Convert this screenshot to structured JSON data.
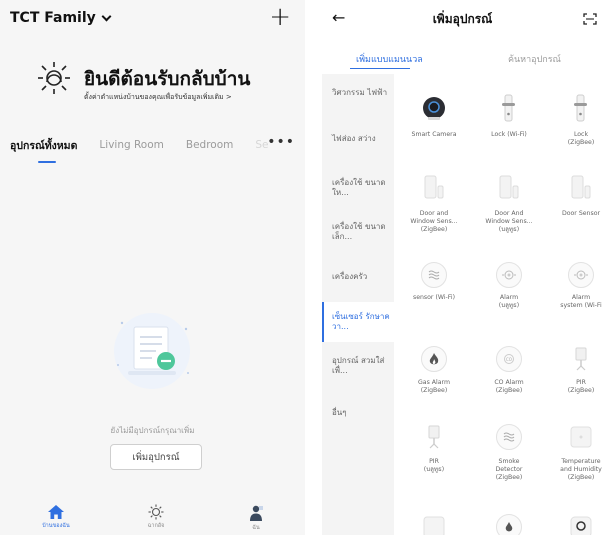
{
  "home": {
    "family_name": "TCT Family",
    "welcome_title": "ยินดีต้อนรับกลับบ้าน",
    "welcome_subtitle": "ตั้งค่าตำแหน่งบ้านของคุณเพื่อรับข้อมูลเพิ่มเติม >",
    "tabs": [
      {
        "label": "อุปกรณ์ทั้งหมด"
      },
      {
        "label": "Living Room"
      },
      {
        "label": "Bedroom"
      },
      {
        "label": "Se"
      }
    ],
    "empty_text": "ยังไม่มีอุปกรณ์กรุณาเพิ่ม",
    "add_button": "เพิ่มอุปกรณ์",
    "bottom_nav": [
      {
        "label": "บ้านของฉัน"
      },
      {
        "label": "ฉากอัจ"
      },
      {
        "label": "ฉัน"
      }
    ],
    "accent_color": "#2f6fe0"
  },
  "add_device": {
    "title": "เพิ่มอุปกรณ์",
    "tabs": [
      {
        "label": "เพิ่มแบบแมนนวล"
      },
      {
        "label": "ค้นหาอุปกรณ์"
      }
    ],
    "categories": [
      {
        "label": "วิศวกรรม\nไฟฟ้า"
      },
      {
        "label": "ไฟส่อง\nสว่าง"
      },
      {
        "label": "เครื่องใช้\nขนาดให..."
      },
      {
        "label": "เครื่องใช้\nขนาดเล็ก..."
      },
      {
        "label": "เครื่องครัว"
      },
      {
        "label": "เซ็นเซอร์\nรักษาควา..."
      },
      {
        "label": "อุปกรณ์\nสวมใส่เพื่..."
      },
      {
        "label": "อื่นๆ"
      }
    ],
    "devices": [
      {
        "label": "Smart Camera",
        "icon": "camera-icon"
      },
      {
        "label": "Lock (Wi-Fi)",
        "icon": "lock-icon"
      },
      {
        "label": "Lock\n(ZigBee)",
        "icon": "lock-icon"
      },
      {
        "label": "Door and\nWindow Sens...\n(ZigBee)",
        "icon": "door-sensor-icon"
      },
      {
        "label": "Door And\nWindow Sens...\n(บลูทูธ)",
        "icon": "door-sensor-icon"
      },
      {
        "label": "Door Sensor",
        "icon": "door-sensor-icon"
      },
      {
        "label": "sensor (Wi-Fi)",
        "icon": "smoke-sensor-icon"
      },
      {
        "label": "Alarm\n(บลูทูธ)",
        "icon": "alarm-icon"
      },
      {
        "label": "Alarm\nsystem (Wi-Fi",
        "icon": "alarm-icon"
      },
      {
        "label": "Gas Alarm\n(ZigBee)",
        "icon": "gas-flame-icon"
      },
      {
        "label": "CO Alarm\n(ZigBee)",
        "icon": "co-alarm-icon"
      },
      {
        "label": "PIR\n(ZigBee)",
        "icon": "pir-sensor-icon"
      },
      {
        "label": "PIR\n(บลูทูธ)",
        "icon": "pir-sensor-icon"
      },
      {
        "label": "Smoke\nDetector\n(ZigBee)",
        "icon": "smoke-detector-icon"
      },
      {
        "label": "Temperature\nand Humidity\n(ZigBee)",
        "icon": "temperature-humidity-icon"
      }
    ]
  }
}
